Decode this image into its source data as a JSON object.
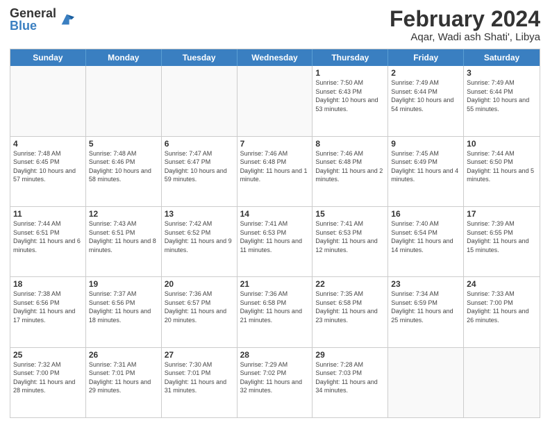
{
  "logo": {
    "general": "General",
    "blue": "Blue"
  },
  "header": {
    "title": "February 2024",
    "location": "Aqar, Wadi ash Shati', Libya"
  },
  "weekdays": [
    "Sunday",
    "Monday",
    "Tuesday",
    "Wednesday",
    "Thursday",
    "Friday",
    "Saturday"
  ],
  "weeks": [
    [
      {
        "day": "",
        "info": ""
      },
      {
        "day": "",
        "info": ""
      },
      {
        "day": "",
        "info": ""
      },
      {
        "day": "",
        "info": ""
      },
      {
        "day": "1",
        "info": "Sunrise: 7:50 AM\nSunset: 6:43 PM\nDaylight: 10 hours and 53 minutes."
      },
      {
        "day": "2",
        "info": "Sunrise: 7:49 AM\nSunset: 6:44 PM\nDaylight: 10 hours and 54 minutes."
      },
      {
        "day": "3",
        "info": "Sunrise: 7:49 AM\nSunset: 6:44 PM\nDaylight: 10 hours and 55 minutes."
      }
    ],
    [
      {
        "day": "4",
        "info": "Sunrise: 7:48 AM\nSunset: 6:45 PM\nDaylight: 10 hours and 57 minutes."
      },
      {
        "day": "5",
        "info": "Sunrise: 7:48 AM\nSunset: 6:46 PM\nDaylight: 10 hours and 58 minutes."
      },
      {
        "day": "6",
        "info": "Sunrise: 7:47 AM\nSunset: 6:47 PM\nDaylight: 10 hours and 59 minutes."
      },
      {
        "day": "7",
        "info": "Sunrise: 7:46 AM\nSunset: 6:48 PM\nDaylight: 11 hours and 1 minute."
      },
      {
        "day": "8",
        "info": "Sunrise: 7:46 AM\nSunset: 6:48 PM\nDaylight: 11 hours and 2 minutes."
      },
      {
        "day": "9",
        "info": "Sunrise: 7:45 AM\nSunset: 6:49 PM\nDaylight: 11 hours and 4 minutes."
      },
      {
        "day": "10",
        "info": "Sunrise: 7:44 AM\nSunset: 6:50 PM\nDaylight: 11 hours and 5 minutes."
      }
    ],
    [
      {
        "day": "11",
        "info": "Sunrise: 7:44 AM\nSunset: 6:51 PM\nDaylight: 11 hours and 6 minutes."
      },
      {
        "day": "12",
        "info": "Sunrise: 7:43 AM\nSunset: 6:51 PM\nDaylight: 11 hours and 8 minutes."
      },
      {
        "day": "13",
        "info": "Sunrise: 7:42 AM\nSunset: 6:52 PM\nDaylight: 11 hours and 9 minutes."
      },
      {
        "day": "14",
        "info": "Sunrise: 7:41 AM\nSunset: 6:53 PM\nDaylight: 11 hours and 11 minutes."
      },
      {
        "day": "15",
        "info": "Sunrise: 7:41 AM\nSunset: 6:53 PM\nDaylight: 11 hours and 12 minutes."
      },
      {
        "day": "16",
        "info": "Sunrise: 7:40 AM\nSunset: 6:54 PM\nDaylight: 11 hours and 14 minutes."
      },
      {
        "day": "17",
        "info": "Sunrise: 7:39 AM\nSunset: 6:55 PM\nDaylight: 11 hours and 15 minutes."
      }
    ],
    [
      {
        "day": "18",
        "info": "Sunrise: 7:38 AM\nSunset: 6:56 PM\nDaylight: 11 hours and 17 minutes."
      },
      {
        "day": "19",
        "info": "Sunrise: 7:37 AM\nSunset: 6:56 PM\nDaylight: 11 hours and 18 minutes."
      },
      {
        "day": "20",
        "info": "Sunrise: 7:36 AM\nSunset: 6:57 PM\nDaylight: 11 hours and 20 minutes."
      },
      {
        "day": "21",
        "info": "Sunrise: 7:36 AM\nSunset: 6:58 PM\nDaylight: 11 hours and 21 minutes."
      },
      {
        "day": "22",
        "info": "Sunrise: 7:35 AM\nSunset: 6:58 PM\nDaylight: 11 hours and 23 minutes."
      },
      {
        "day": "23",
        "info": "Sunrise: 7:34 AM\nSunset: 6:59 PM\nDaylight: 11 hours and 25 minutes."
      },
      {
        "day": "24",
        "info": "Sunrise: 7:33 AM\nSunset: 7:00 PM\nDaylight: 11 hours and 26 minutes."
      }
    ],
    [
      {
        "day": "25",
        "info": "Sunrise: 7:32 AM\nSunset: 7:00 PM\nDaylight: 11 hours and 28 minutes."
      },
      {
        "day": "26",
        "info": "Sunrise: 7:31 AM\nSunset: 7:01 PM\nDaylight: 11 hours and 29 minutes."
      },
      {
        "day": "27",
        "info": "Sunrise: 7:30 AM\nSunset: 7:01 PM\nDaylight: 11 hours and 31 minutes."
      },
      {
        "day": "28",
        "info": "Sunrise: 7:29 AM\nSunset: 7:02 PM\nDaylight: 11 hours and 32 minutes."
      },
      {
        "day": "29",
        "info": "Sunrise: 7:28 AM\nSunset: 7:03 PM\nDaylight: 11 hours and 34 minutes."
      },
      {
        "day": "",
        "info": ""
      },
      {
        "day": "",
        "info": ""
      }
    ]
  ]
}
